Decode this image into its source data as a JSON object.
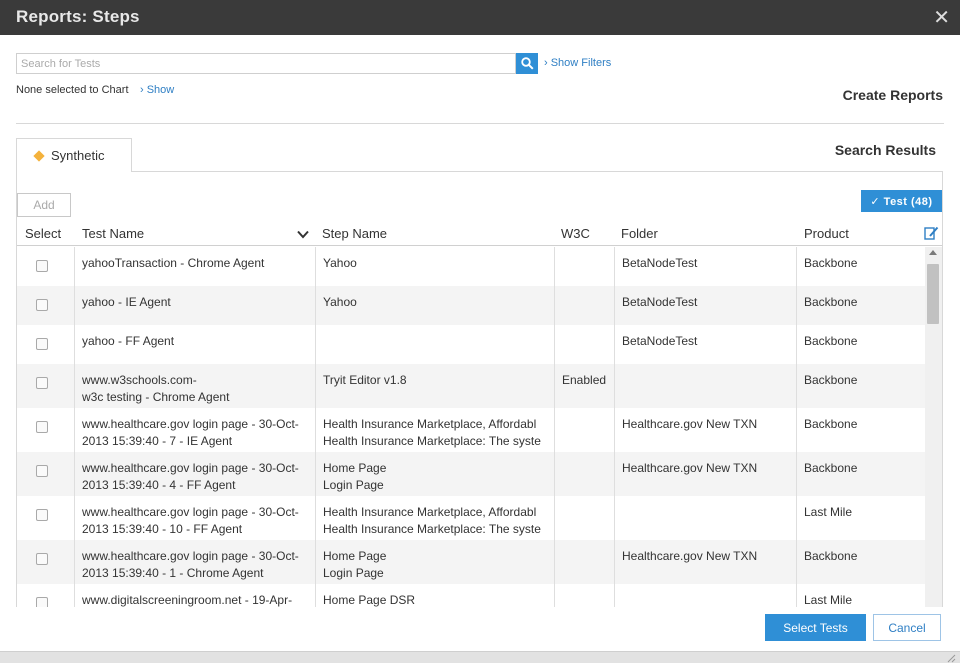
{
  "dialog": {
    "title": "Reports: Steps",
    "close_glyph": "✕"
  },
  "search": {
    "placeholder": "Search for Tests",
    "value": "",
    "show_filters": "› Show Filters"
  },
  "selection": {
    "none_selected": "None selected to Chart",
    "show_link": "› Show"
  },
  "headings": {
    "create_reports": "Create Reports",
    "search_results": "Search Results"
  },
  "tab": {
    "label": "Synthetic",
    "icon": "diamond-icon",
    "icon_color": "#f4b23c"
  },
  "toolbar": {
    "add_label": "Add",
    "test_badge": "✓ Test  (48)"
  },
  "columns": [
    "Select",
    "Test Name",
    "Step Name",
    "W3C",
    "Folder",
    "Product"
  ],
  "rows": [
    {
      "test_name": [
        "yahooTransaction - Chrome Agent"
      ],
      "step_name": [
        "Yahoo"
      ],
      "w3c": "",
      "folder": "BetaNodeTest",
      "product": "Backbone"
    },
    {
      "test_name": [
        "yahoo - IE Agent"
      ],
      "step_name": [
        "Yahoo"
      ],
      "w3c": "",
      "folder": "BetaNodeTest",
      "product": "Backbone"
    },
    {
      "test_name": [
        "yahoo - FF Agent"
      ],
      "step_name": [
        ""
      ],
      "w3c": "",
      "folder": "BetaNodeTest",
      "product": "Backbone"
    },
    {
      "test_name": [
        "www.w3schools.com-",
        "w3c testing - Chrome Agent"
      ],
      "step_name": [
        "Tryit Editor v1.8"
      ],
      "w3c": "Enabled",
      "folder": "",
      "product": "Backbone"
    },
    {
      "test_name": [
        "www.healthcare.gov login page - 30-Oct-",
        "2013 15:39:40 - 7 - IE Agent"
      ],
      "step_name": [
        "Health Insurance Marketplace, Affordabl",
        "Health Insurance Marketplace: The syste"
      ],
      "w3c": "",
      "folder": "Healthcare.gov New TXN",
      "product": "Backbone"
    },
    {
      "test_name": [
        "www.healthcare.gov login page - 30-Oct-",
        "2013 15:39:40 - 4 - FF Agent"
      ],
      "step_name": [
        "Home Page",
        "Login Page"
      ],
      "w3c": "",
      "folder": "Healthcare.gov New TXN",
      "product": "Backbone"
    },
    {
      "test_name": [
        "www.healthcare.gov login page - 30-Oct-",
        "2013 15:39:40 - 10 - FF Agent"
      ],
      "step_name": [
        "Health Insurance Marketplace, Affordabl",
        "Health Insurance Marketplace: The syste"
      ],
      "w3c": "",
      "folder": "",
      "product": "Last Mile"
    },
    {
      "test_name": [
        "www.healthcare.gov login page - 30-Oct-",
        "2013 15:39:40 - 1 - Chrome Agent"
      ],
      "step_name": [
        "Home Page",
        "Login Page"
      ],
      "w3c": "",
      "folder": "Healthcare.gov New TXN",
      "product": "Backbone"
    },
    {
      "test_name": [
        "www.digitalscreeningroom.net - 19-Apr-"
      ],
      "step_name": [
        "Home Page DSR"
      ],
      "w3c": "",
      "folder": "",
      "product": "Last Mile"
    }
  ],
  "footer": {
    "select_tests": "Select Tests",
    "cancel": "Cancel"
  },
  "colors": {
    "accent": "#2f8fd6",
    "titlebar": "#3a3a3a",
    "row_alt": "#f4f4f4"
  }
}
